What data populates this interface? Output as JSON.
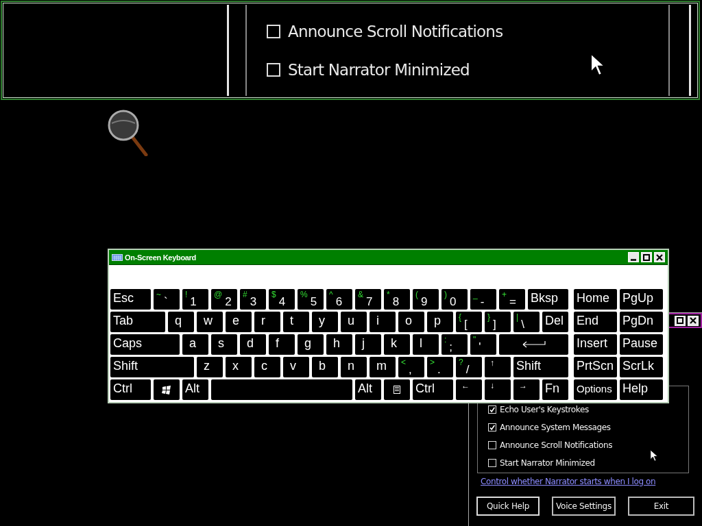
{
  "magnifier_view": {
    "checkboxes": [
      {
        "label": "Announce Scroll Notifications",
        "checked": false
      },
      {
        "label": "Start Narrator Minimized",
        "checked": false
      }
    ]
  },
  "keyboard": {
    "title": "On-Screen Keyboard",
    "rows": [
      {
        "keys": [
          {
            "kind": "text",
            "label": "Esc"
          },
          {
            "kind": "char",
            "shift": "~",
            "label": "`"
          },
          {
            "kind": "char",
            "shift": "!",
            "label": "1"
          },
          {
            "kind": "char",
            "shift": "@",
            "label": "2"
          },
          {
            "kind": "char",
            "shift": "#",
            "label": "3"
          },
          {
            "kind": "char",
            "shift": "$",
            "label": "4"
          },
          {
            "kind": "char",
            "shift": "%",
            "label": "5"
          },
          {
            "kind": "char",
            "shift": "^",
            "label": "6"
          },
          {
            "kind": "char",
            "shift": "&",
            "label": "7"
          },
          {
            "kind": "char",
            "shift": "*",
            "label": "8"
          },
          {
            "kind": "char",
            "shift": "(",
            "label": "9"
          },
          {
            "kind": "char",
            "shift": ")",
            "label": "0"
          },
          {
            "kind": "char",
            "shift": "_",
            "label": "-"
          },
          {
            "kind": "char",
            "shift": "+",
            "label": "="
          },
          {
            "kind": "text",
            "label": "Bksp"
          }
        ]
      },
      {
        "keys": [
          {
            "kind": "text",
            "label": "Tab"
          },
          {
            "kind": "letter",
            "label": "q"
          },
          {
            "kind": "letter",
            "label": "w"
          },
          {
            "kind": "letter",
            "label": "e"
          },
          {
            "kind": "letter",
            "label": "r"
          },
          {
            "kind": "letter",
            "label": "t"
          },
          {
            "kind": "letter",
            "label": "y"
          },
          {
            "kind": "letter",
            "label": "u"
          },
          {
            "kind": "letter",
            "label": "i"
          },
          {
            "kind": "letter",
            "label": "o"
          },
          {
            "kind": "letter",
            "label": "p"
          },
          {
            "kind": "char",
            "shift": "{",
            "label": "["
          },
          {
            "kind": "char",
            "shift": "}",
            "label": "]"
          },
          {
            "kind": "char",
            "shift": "|",
            "label": "\\"
          },
          {
            "kind": "text",
            "label": "Del"
          }
        ]
      },
      {
        "keys": [
          {
            "kind": "text",
            "label": "Caps"
          },
          {
            "kind": "letter",
            "label": "a"
          },
          {
            "kind": "letter",
            "label": "s"
          },
          {
            "kind": "letter",
            "label": "d"
          },
          {
            "kind": "letter",
            "label": "f"
          },
          {
            "kind": "letter",
            "label": "g"
          },
          {
            "kind": "letter",
            "label": "h"
          },
          {
            "kind": "letter",
            "label": "j"
          },
          {
            "kind": "letter",
            "label": "k"
          },
          {
            "kind": "letter",
            "label": "l"
          },
          {
            "kind": "char",
            "shift": ":",
            "label": ";"
          },
          {
            "kind": "char",
            "shift": "\"",
            "label": "'"
          },
          {
            "kind": "enter"
          }
        ]
      },
      {
        "keys": [
          {
            "kind": "text",
            "label": "Shift"
          },
          {
            "kind": "letter",
            "label": "z"
          },
          {
            "kind": "letter",
            "label": "x"
          },
          {
            "kind": "letter",
            "label": "c"
          },
          {
            "kind": "letter",
            "label": "v"
          },
          {
            "kind": "letter",
            "label": "b"
          },
          {
            "kind": "letter",
            "label": "n"
          },
          {
            "kind": "letter",
            "label": "m"
          },
          {
            "kind": "char",
            "shift": "<",
            "label": ","
          },
          {
            "kind": "char",
            "shift": ">",
            "label": "."
          },
          {
            "kind": "char",
            "shift": "?",
            "label": "/"
          },
          {
            "kind": "arrow",
            "label": "↑"
          },
          {
            "kind": "text",
            "label": "Shift"
          }
        ]
      },
      {
        "keys": [
          {
            "kind": "text",
            "label": "Ctrl"
          },
          {
            "kind": "windows"
          },
          {
            "kind": "text",
            "label": "Alt"
          },
          {
            "kind": "space"
          },
          {
            "kind": "text",
            "label": "Alt"
          },
          {
            "kind": "menu"
          },
          {
            "kind": "text",
            "label": "Ctrl"
          },
          {
            "kind": "arrow",
            "label": "←"
          },
          {
            "kind": "arrow",
            "label": "↓"
          },
          {
            "kind": "arrow",
            "label": "→"
          },
          {
            "kind": "text",
            "label": "Fn"
          }
        ]
      }
    ],
    "side_rows": [
      [
        {
          "kind": "text",
          "label": "Home"
        },
        {
          "kind": "text",
          "label": "PgUp"
        }
      ],
      [
        {
          "kind": "text",
          "label": "End"
        },
        {
          "kind": "text",
          "label": "PgDn"
        }
      ],
      [
        {
          "kind": "text",
          "label": "Insert"
        },
        {
          "kind": "text",
          "label": "Pause"
        }
      ],
      [
        {
          "kind": "text",
          "label": "PrtScn"
        },
        {
          "kind": "text",
          "label": "ScrLk"
        }
      ],
      [
        {
          "kind": "small",
          "label": "Options"
        },
        {
          "kind": "text",
          "label": "Help"
        }
      ]
    ]
  },
  "narrator": {
    "checkboxes": [
      {
        "label": "Echo User's Keystrokes",
        "checked": true
      },
      {
        "label": "Announce System Messages",
        "checked": true
      },
      {
        "label": "Announce Scroll Notifications",
        "checked": false
      },
      {
        "label": "Start Narrator Minimized",
        "checked": false
      }
    ],
    "link": "Control whether Narrator starts when I log on",
    "buttons": [
      "Quick Help",
      "Voice Settings",
      "Exit"
    ]
  }
}
